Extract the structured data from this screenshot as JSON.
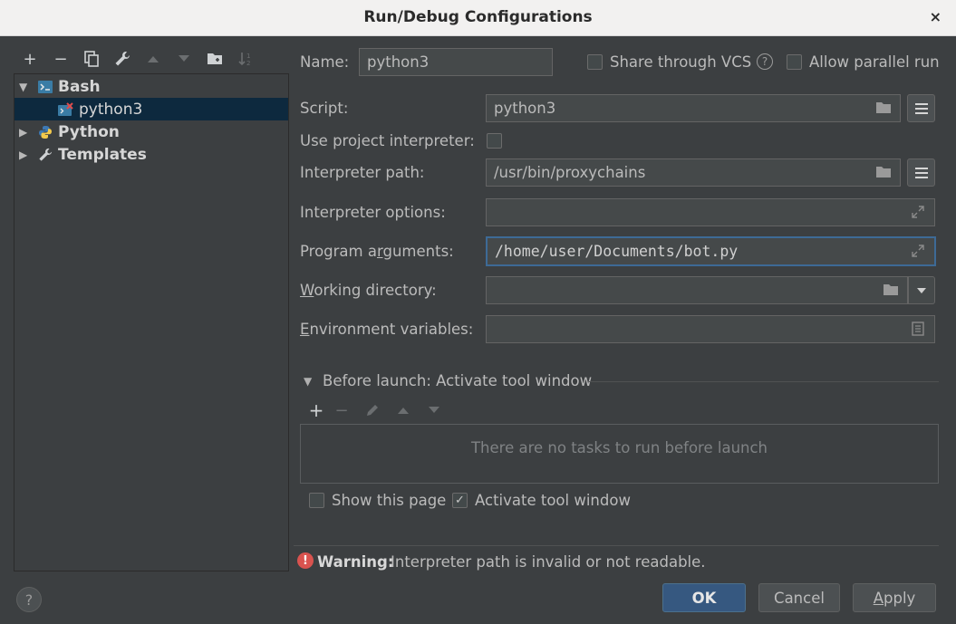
{
  "window": {
    "title": "Run/Debug Configurations",
    "close_glyph": "×"
  },
  "left_toolbar": {
    "add": "+",
    "remove": "−",
    "copy": "⧉",
    "edit": "🔧",
    "up": "▲",
    "down": "▼",
    "folder": "▆",
    "sort": "⇅"
  },
  "tree": {
    "items": [
      {
        "label": "Bash",
        "icon": "bash-icon"
      },
      {
        "label": "python3",
        "icon": "bash-script-error-icon"
      },
      {
        "label": "Python",
        "icon": "python-icon"
      },
      {
        "label": "Templates",
        "icon": "wrench-icon"
      }
    ]
  },
  "form": {
    "name_label": "Name:",
    "name_value": "python3",
    "share_label": "Share through VCS",
    "parallel_label": "Allow parallel run",
    "script_label": "Script:",
    "script_value": "python3",
    "use_project_label": "Use project interpreter:",
    "interp_path_label": "Interpreter path:",
    "interp_path_value": "/usr/bin/proxychains",
    "interp_options_label": "Interpreter options:",
    "interp_options_value": "",
    "program_args_label": "Program arguments:",
    "program_args_value": "/home/user/Documents/bot.py",
    "working_dir_label": "Working directory:",
    "working_dir_value": "",
    "env_label": "Environment variables:",
    "env_value": ""
  },
  "before_launch": {
    "header": "Before launch: Activate tool window",
    "empty_text": "There are no tasks to run before launch",
    "show_page_label": "Show this page",
    "activate_label": "Activate tool window"
  },
  "warning": {
    "label": "Warning:",
    "message": "Interpreter path is invalid or not readable."
  },
  "buttons": {
    "ok": "OK",
    "cancel": "Cancel",
    "apply": "Apply",
    "help": "?"
  }
}
